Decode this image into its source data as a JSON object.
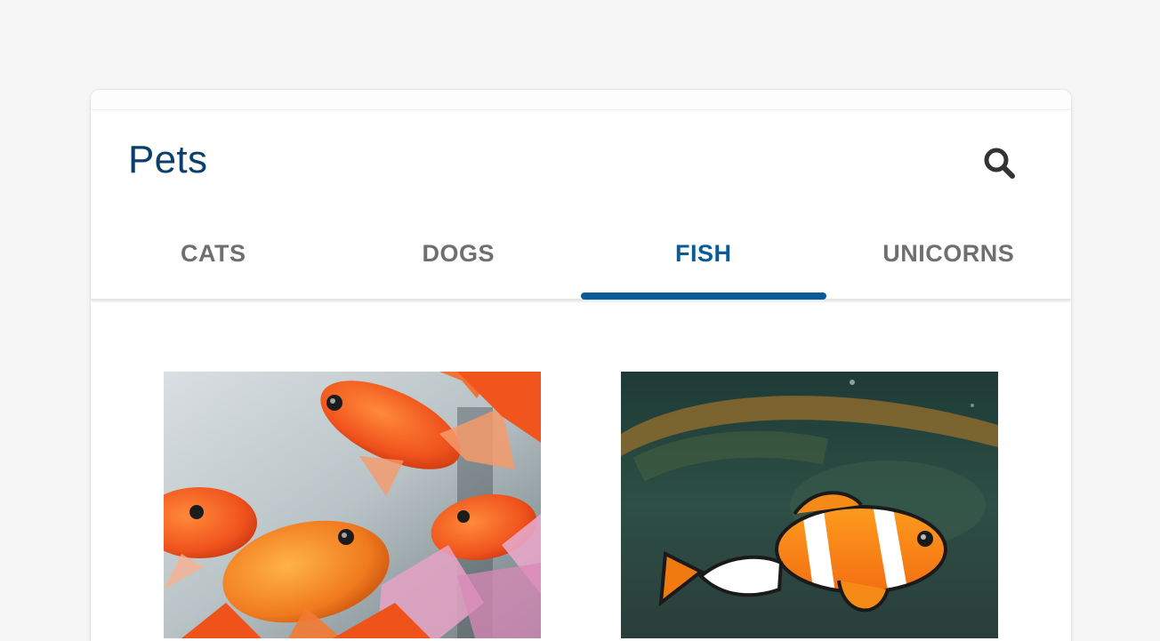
{
  "app": {
    "title": "Pets",
    "search_icon": "search-icon"
  },
  "tabs": [
    {
      "label": "CATS",
      "active": false
    },
    {
      "label": "DOGS",
      "active": false
    },
    {
      "label": "FISH",
      "active": true
    },
    {
      "label": "UNICORNS",
      "active": false
    }
  ],
  "colors": {
    "background": "#f6f6f6",
    "title": "#0b3f6b",
    "active_tab": "#0a5c99",
    "inactive_tab": "#6f6f6f",
    "icon": "#333333"
  },
  "gallery": {
    "items": [
      {
        "subject": "goldfish"
      },
      {
        "subject": "clownfish"
      }
    ]
  }
}
